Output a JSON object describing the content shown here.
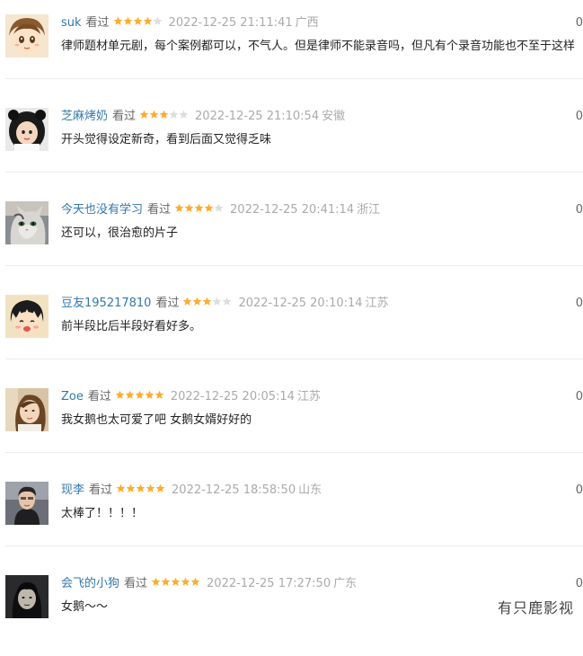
{
  "colors": {
    "username": "#3377aa",
    "star_filled": "#ffac2d",
    "star_empty": "#dddddd",
    "meta_gray": "#aaaaaa",
    "content_text": "#222222"
  },
  "comments": [
    {
      "user": "suk",
      "status": "看过",
      "rating": 4,
      "time": "2022-12-25 21:11:41",
      "location": "广西",
      "votes": "0",
      "content": "律师题材单元剧，每个案例都可以，不气人。但是律师不能录音吗，但凡有个录音功能也不至于这样",
      "avatar_icon": "cartoon-boy-avatar"
    },
    {
      "user": "芝麻烤奶",
      "status": "看过",
      "rating": 3,
      "time": "2022-12-25 21:10:54",
      "location": "安徽",
      "votes": "0",
      "content": "开头觉得设定新奇，看到后面又觉得乏味",
      "avatar_icon": "panda-costume-avatar"
    },
    {
      "user": "今天也没有学习",
      "status": "看过",
      "rating": 4,
      "time": "2022-12-25 20:41:14",
      "location": "浙江",
      "votes": "0",
      "content": "还可以，很治愈的片子",
      "avatar_icon": "cat-avatar"
    },
    {
      "user": "豆友195217810",
      "status": "看过",
      "rating": 3,
      "time": "2022-12-25 20:10:14",
      "location": "江苏",
      "votes": "0",
      "content": "前半段比后半段好看好多。",
      "avatar_icon": "cartoon-girl-avatar"
    },
    {
      "user": "Zoe",
      "status": "看过",
      "rating": 5,
      "time": "2022-12-25 20:05:14",
      "location": "江苏",
      "votes": "0",
      "content": "我女鹅也太可爱了吧 女鹅女婿好好的",
      "avatar_icon": "girl-photo-avatar"
    },
    {
      "user": "现李",
      "status": "看过",
      "rating": 5,
      "time": "2022-12-25 18:58:50",
      "location": "山东",
      "votes": "0",
      "content": "太棒了！！！！",
      "avatar_icon": "man-photo-avatar"
    },
    {
      "user": "会飞的小狗",
      "status": "看过",
      "rating": 5,
      "time": "2022-12-25 17:27:50",
      "location": "广东",
      "votes": "0",
      "content": "女鹅～～",
      "avatar_icon": "dark-portrait-avatar"
    }
  ],
  "watermark": "有只鹿影视"
}
